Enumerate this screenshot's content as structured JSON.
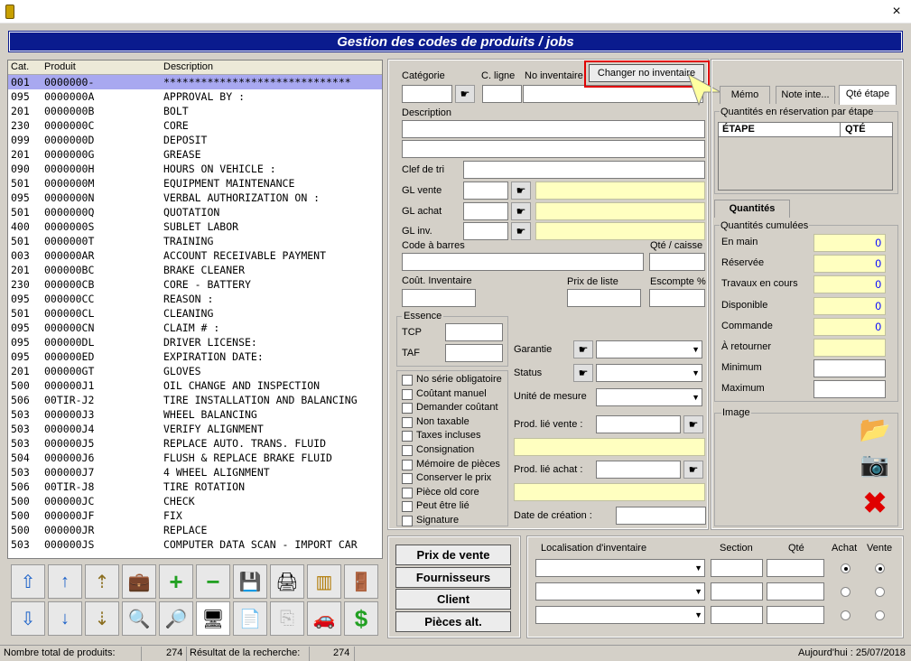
{
  "window": {
    "close_label": "×"
  },
  "banner": "Gestion des codes de produits / jobs",
  "list": {
    "headers": [
      "Cat.",
      "Produit",
      "Description"
    ],
    "rows": [
      [
        "001",
        "0000000-",
        "******************************"
      ],
      [
        "095",
        "0000000A",
        "APPROVAL BY :"
      ],
      [
        "201",
        "0000000B",
        "BOLT"
      ],
      [
        "230",
        "0000000C",
        "CORE"
      ],
      [
        "099",
        "0000000D",
        "DEPOSIT"
      ],
      [
        "201",
        "0000000G",
        "GREASE"
      ],
      [
        "090",
        "0000000H",
        "HOURS ON VEHICLE :"
      ],
      [
        "501",
        "0000000M",
        "EQUIPMENT MAINTENANCE"
      ],
      [
        "095",
        "0000000N",
        "VERBAL AUTHORIZATION ON :"
      ],
      [
        "501",
        "0000000Q",
        "QUOTATION"
      ],
      [
        "400",
        "0000000S",
        "SUBLET LABOR"
      ],
      [
        "501",
        "0000000T",
        "TRAINING"
      ],
      [
        "003",
        "000000AR",
        "ACCOUNT RECEIVABLE PAYMENT"
      ],
      [
        "201",
        "000000BC",
        "BRAKE CLEANER"
      ],
      [
        "230",
        "000000CB",
        "CORE - BATTERY"
      ],
      [
        "095",
        "000000CC",
        "REASON :"
      ],
      [
        "501",
        "000000CL",
        "CLEANING"
      ],
      [
        "095",
        "000000CN",
        "CLAIM # :"
      ],
      [
        "095",
        "000000DL",
        "DRIVER LICENSE:"
      ],
      [
        "095",
        "000000ED",
        "EXPIRATION DATE:"
      ],
      [
        "201",
        "000000GT",
        "GLOVES"
      ],
      [
        "500",
        "000000J1",
        "OIL CHANGE AND INSPECTION"
      ],
      [
        "506",
        "00TIR-J2",
        "TIRE INSTALLATION AND BALANCING"
      ],
      [
        "503",
        "000000J3",
        "WHEEL BALANCING"
      ],
      [
        "503",
        "000000J4",
        "VERIFY ALIGNMENT"
      ],
      [
        "503",
        "000000J5",
        "REPLACE AUTO. TRANS. FLUID"
      ],
      [
        "504",
        "000000J6",
        "FLUSH & REPLACE BRAKE FLUID"
      ],
      [
        "503",
        "000000J7",
        "4 WHEEL ALIGNMENT"
      ],
      [
        "506",
        "00TIR-J8",
        "TIRE ROTATION"
      ],
      [
        "500",
        "000000JC",
        "CHECK"
      ],
      [
        "500",
        "000000JF",
        "FIX"
      ],
      [
        "500",
        "000000JR",
        "REPLACE"
      ],
      [
        "503",
        "000000JS",
        "COMPUTER DATA SCAN - IMPORT CAR"
      ]
    ]
  },
  "form": {
    "categorie": "Catégorie",
    "c_ligne": "C. ligne",
    "no_inventaire": "No inventaire",
    "changer_btn": "Changer no inventaire",
    "description": "Description",
    "clef_tri": "Clef de tri",
    "gl_vente": "GL vente",
    "gl_achat": "GL achat",
    "gl_inv": "GL inv.",
    "code_barres": "Code à barres",
    "qte_caisse": "Qté / caisse",
    "cout_inventaire": "Coût. Inventaire",
    "prix_liste": "Prix de liste",
    "escompte": "Escompte %",
    "essence": "Essence",
    "tcp": "TCP",
    "taf": "TAF",
    "garantie": "Garantie",
    "status": "Status",
    "unite_mesure": "Unité de mesure",
    "prod_lie_vente": "Prod. lié vente :",
    "prod_lie_achat": "Prod. lié achat :",
    "date_creation": "Date de création :",
    "checkboxes": [
      "No série obligatoire",
      "Coûtant manuel",
      "Demander coûtant",
      "Non taxable",
      "Taxes incluses",
      "Consignation",
      "Mémoire de pièces",
      "Conserver le prix",
      "Pièce old core",
      "Peut être lié",
      "Signature"
    ]
  },
  "tabs_top": [
    "Mémo",
    "Note inte...",
    "Qté étape"
  ],
  "reservation": {
    "title": "Quantités en réservation par étape",
    "col1": "ÉTAPE",
    "col2": "QTÉ"
  },
  "quantites": {
    "tab": "Quantités",
    "group": "Quantités cumulées",
    "items": [
      {
        "label": "En main",
        "value": "0"
      },
      {
        "label": "Réservée",
        "value": "0"
      },
      {
        "label": "Travaux en cours",
        "value": "0"
      },
      {
        "label": "Disponible",
        "value": "0"
      },
      {
        "label": "Commande",
        "value": "0"
      },
      {
        "label": "À retourner",
        "value": ""
      },
      {
        "label": "Minimum",
        "value": ""
      },
      {
        "label": "Maximum",
        "value": ""
      }
    ]
  },
  "image_label": "Image",
  "buttons": [
    "Prix de vente",
    "Fournisseurs",
    "Client",
    "Pièces alt."
  ],
  "localisation": {
    "header": "Localisation d'inventaire",
    "section": "Section",
    "qte": "Qté",
    "achat": "Achat",
    "vente": "Vente"
  },
  "statusbar": {
    "total_label": "Nombre total de produits:",
    "total": "274",
    "result_label": "Résultat de la recherche:",
    "result": "274",
    "today": "Aujourd'hui : 25/07/2018"
  }
}
